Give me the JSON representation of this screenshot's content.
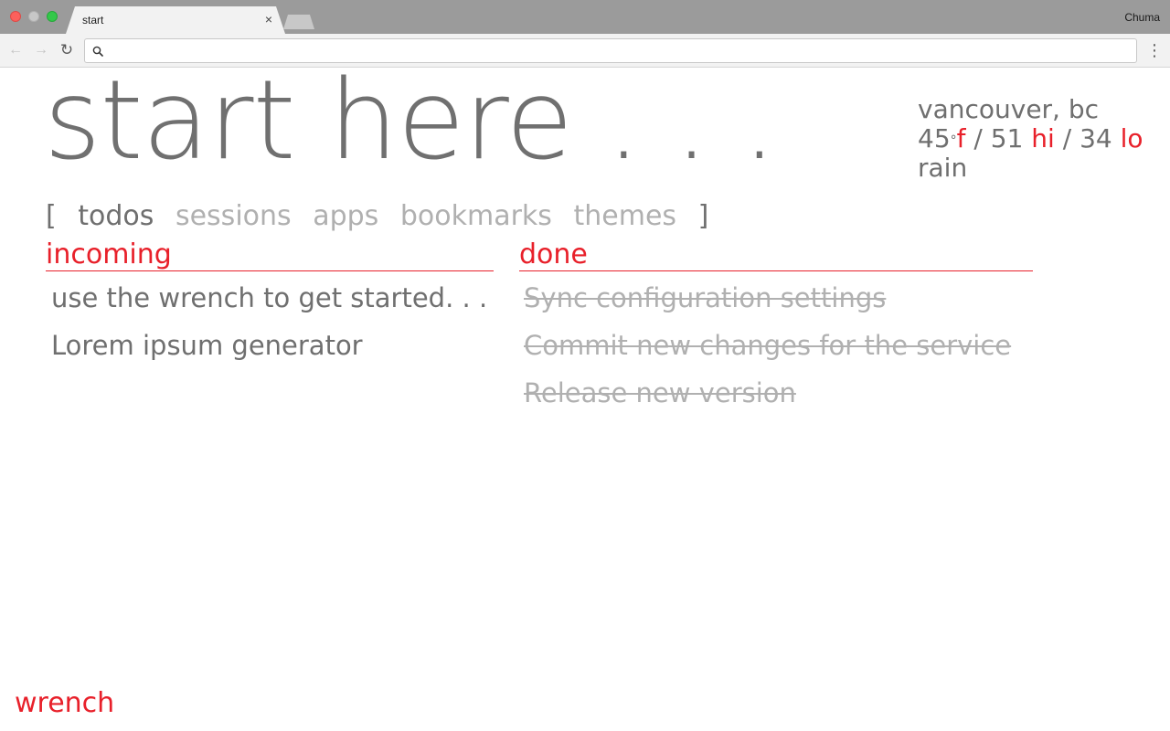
{
  "browser": {
    "tab_title": "start",
    "tab_close": "×",
    "profile_name": "Chuma",
    "address_value": "",
    "back_glyph": "←",
    "forward_glyph": "→",
    "reload_glyph": "↻",
    "menu_glyph": "⋮"
  },
  "page": {
    "title": "start here . . .",
    "weather": {
      "location": "vancouver, bc",
      "temp": "45",
      "degree_symbol": "°",
      "unit": "f",
      "separator": "/",
      "high": "51",
      "high_label": "hi",
      "low": "34",
      "low_label": "lo",
      "condition": "rain"
    },
    "nav": {
      "open_bracket": "[",
      "close_bracket": "]",
      "items": [
        {
          "label": "todos",
          "active": true
        },
        {
          "label": "sessions",
          "active": false
        },
        {
          "label": "apps",
          "active": false
        },
        {
          "label": "bookmarks",
          "active": false
        },
        {
          "label": "themes",
          "active": false
        }
      ]
    },
    "incoming": {
      "heading": "incoming",
      "items": [
        "use the wrench to get started. . .",
        "Lorem ipsum generator"
      ]
    },
    "done": {
      "heading": "done",
      "items": [
        "Sync configuration settings",
        "Commit new changes for the service",
        "Release new version"
      ]
    },
    "wrench_label": "wrench"
  },
  "colors": {
    "accent": "#e8202a",
    "text": "#6f6f6f",
    "muted": "#b0b0b0",
    "titlebar": "#9b9b9b"
  }
}
